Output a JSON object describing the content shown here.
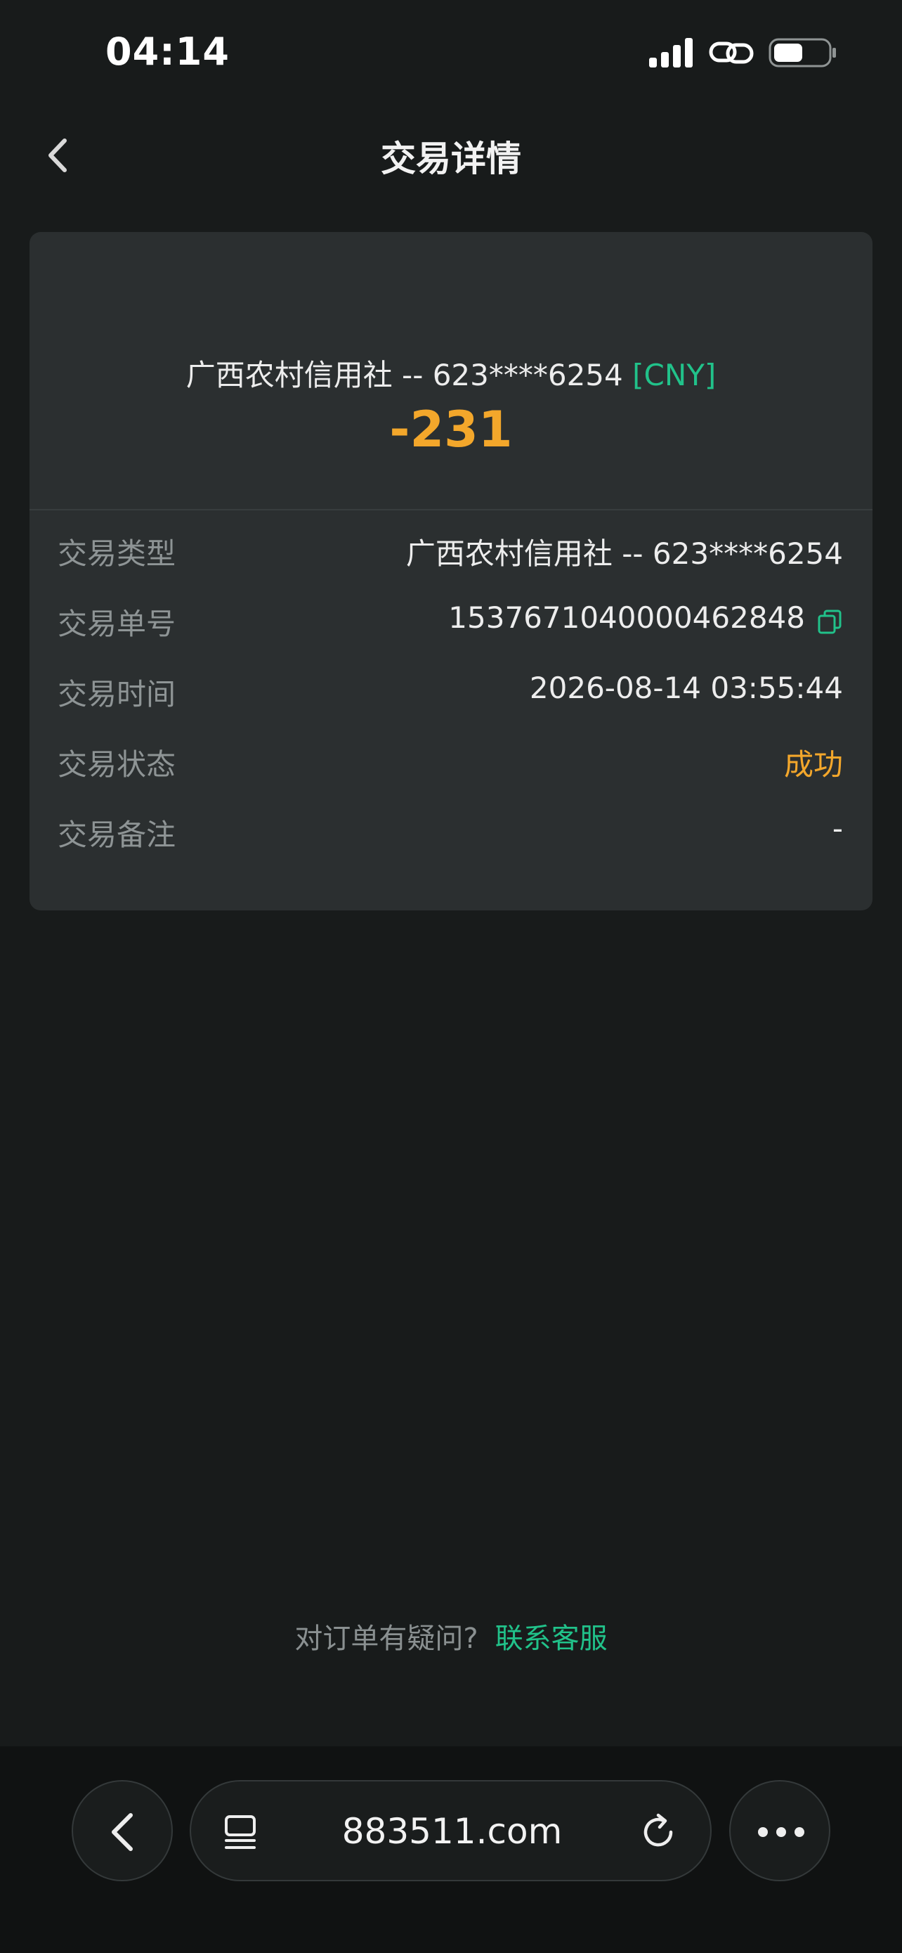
{
  "status_bar": {
    "time": "04:14"
  },
  "header": {
    "title": "交易详情"
  },
  "summary": {
    "bank_account": "广西农村信用社 -- 623****6254",
    "currency": "[CNY]",
    "amount": "-231"
  },
  "details": [
    {
      "label": "交易类型",
      "value": "广西农村信用社 -- 623****6254"
    },
    {
      "label": "交易单号",
      "value": "1537671040000462848"
    },
    {
      "label": "交易时间",
      "value": "2026-08-14 03:55:44"
    },
    {
      "label": "交易状态",
      "value": "成功"
    },
    {
      "label": "交易备注",
      "value": "-"
    }
  ],
  "help": {
    "question": "对订单有疑问?",
    "link": "联系客服"
  },
  "browser": {
    "url": "883511.com"
  },
  "colors": {
    "accent_green": "#21c28a",
    "amount_orange": "#f3a72b",
    "background": "#181b1b",
    "card": "#2b2f30"
  },
  "icons": {
    "back": "chevron-left-icon",
    "copy": "copy-icon",
    "tabs": "tabs-icon",
    "reload": "reload-icon",
    "more": "more-dots-icon"
  }
}
